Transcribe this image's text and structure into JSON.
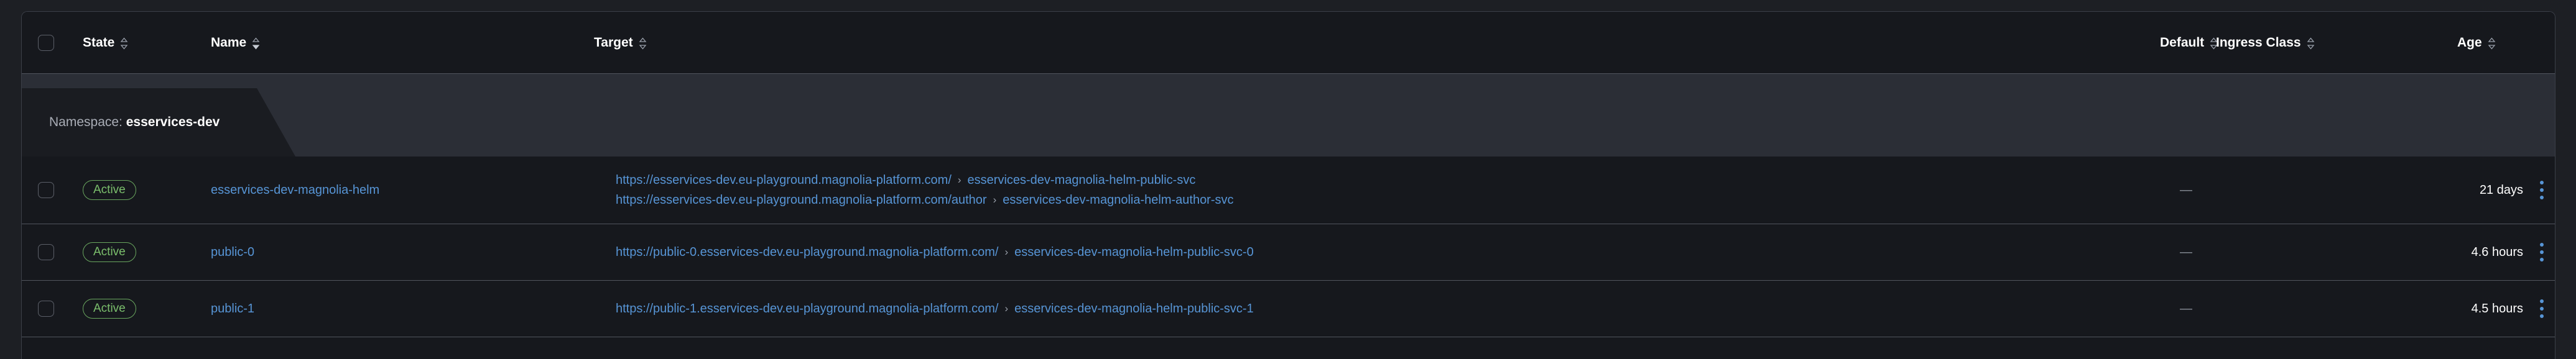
{
  "table": {
    "columns": [
      {
        "key": "select",
        "label": "",
        "sortable": false
      },
      {
        "key": "state",
        "label": "State",
        "sortable": true
      },
      {
        "key": "name",
        "label": "Name",
        "sortable": true
      },
      {
        "key": "target",
        "label": "Target",
        "sortable": true
      },
      {
        "key": "default",
        "label": "Default",
        "sortable": true
      },
      {
        "key": "ingress_class",
        "label": "Ingress Class",
        "sortable": true
      },
      {
        "key": "age",
        "label": "Age",
        "sortable": true
      }
    ],
    "group": {
      "label": "Namespace:",
      "value": "esservices-dev"
    },
    "rows": [
      {
        "state": "Active",
        "name": "esservices-dev-magnolia-helm",
        "targets": [
          {
            "url": "https://esservices-dev.eu-playground.magnolia-platform.com/",
            "separator": "›",
            "service": "esservices-dev-magnolia-helm-public-svc"
          },
          {
            "url": "https://esservices-dev.eu-playground.magnolia-platform.com/author",
            "separator": "›",
            "service": "esservices-dev-magnolia-helm-author-svc"
          }
        ],
        "default": "—",
        "ingress_class": "",
        "age": "21 days",
        "menu_icon": "kebab-menu-icon"
      },
      {
        "state": "Active",
        "name": "public-0",
        "targets": [
          {
            "url": "https://public-0.esservices-dev.eu-playground.magnolia-platform.com/",
            "separator": "›",
            "service": "esservices-dev-magnolia-helm-public-svc-0"
          }
        ],
        "default": "—",
        "ingress_class": "",
        "age": "4.6 hours",
        "menu_icon": "kebab-menu-icon"
      },
      {
        "state": "Active",
        "name": "public-1",
        "targets": [
          {
            "url": "https://public-1.esservices-dev.eu-playground.magnolia-platform.com/",
            "separator": "›",
            "service": "esservices-dev-magnolia-helm-public-svc-1"
          }
        ],
        "default": "—",
        "ingress_class": "",
        "age": "4.5 hours",
        "menu_icon": "kebab-menu-icon"
      }
    ]
  },
  "colors": {
    "page_background": "#1d1f24",
    "table_background": "#16181d",
    "group_band": "#2b2e36",
    "group_tab": "#1a1c21",
    "link": "#5795d6",
    "badge_border": "#6aa75f",
    "badge_text": "#7bbf6c",
    "row_divider": "#51555e",
    "muted_text": "#8a8f99"
  }
}
